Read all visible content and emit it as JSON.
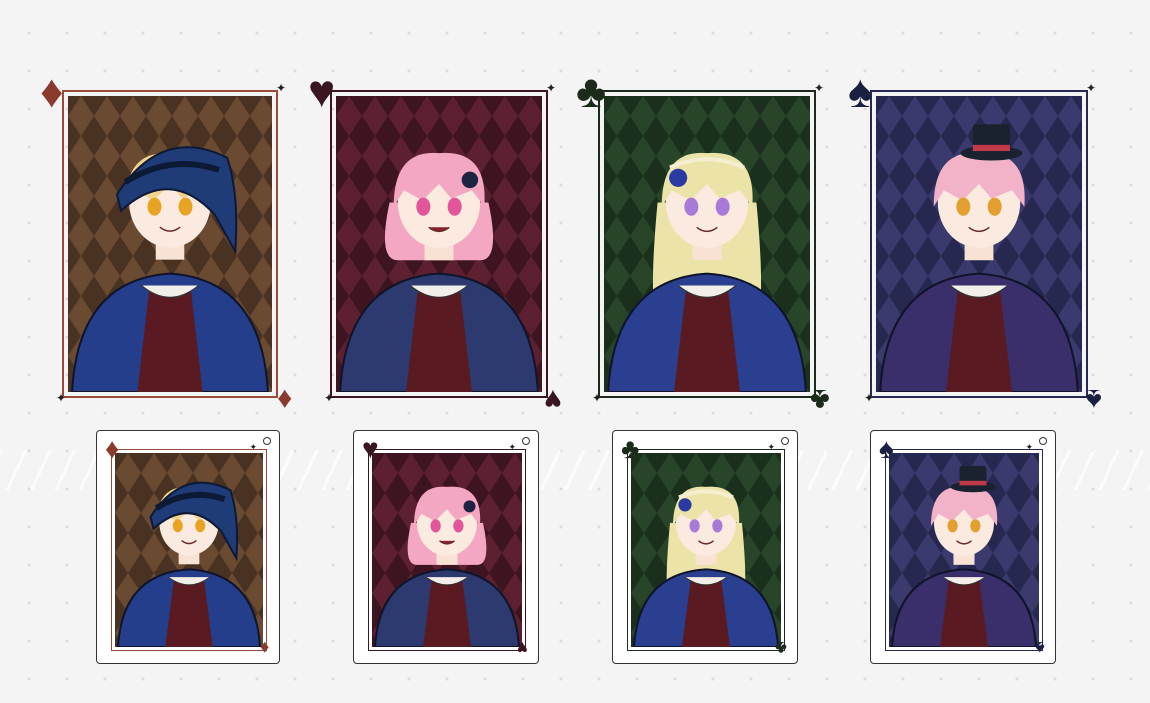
{
  "scene": {
    "background": "#f4f4f5",
    "description_free": true
  },
  "large_cards": [
    {
      "suit": "diamond",
      "suit_glyph": "♦",
      "suit_color": "#8b3a2e",
      "frame_color": "#9a4a3a",
      "pattern_a": "#6b4a32",
      "pattern_b": "#4a3222",
      "hair": "#f2d48c",
      "hat": "#1f3c78",
      "coat": "#243e8c",
      "eye": "#e8a322"
    },
    {
      "suit": "heart",
      "suit_glyph": "♥",
      "suit_color": "#3a1620",
      "frame_color": "#3a1620",
      "pattern_a": "#5c2030",
      "pattern_b": "#3e1420",
      "hair": "#f4a7c2",
      "hat": "",
      "coat": "#2c3a70",
      "eye": "#e2559a"
    },
    {
      "suit": "club",
      "suit_glyph": "♣",
      "suit_color": "#1c2a1c",
      "frame_color": "#1c2a1c",
      "pattern_a": "#28452a",
      "pattern_b": "#1a301c",
      "hair": "#ece3a8",
      "hat": "",
      "coat": "#2a3f90",
      "eye": "#a77ad8"
    },
    {
      "suit": "spade",
      "suit_glyph": "♠",
      "suit_color": "#1c2040",
      "frame_color": "#262a52",
      "pattern_a": "#3a3a6e",
      "pattern_b": "#262850",
      "hair": "#f2b2c8",
      "hat": "#1a2230",
      "coat": "#3a2f6a",
      "eye": "#e2a030"
    }
  ],
  "small_cards": [
    {
      "suit_glyph": "♦",
      "suit_color": "#8b3a2e"
    },
    {
      "suit_glyph": "♥",
      "suit_color": "#3a1620"
    },
    {
      "suit_glyph": "♣",
      "suit_color": "#1c2a1c"
    },
    {
      "suit_glyph": "♠",
      "suit_color": "#1c2040"
    }
  ],
  "sparkle_glyph": "✦"
}
